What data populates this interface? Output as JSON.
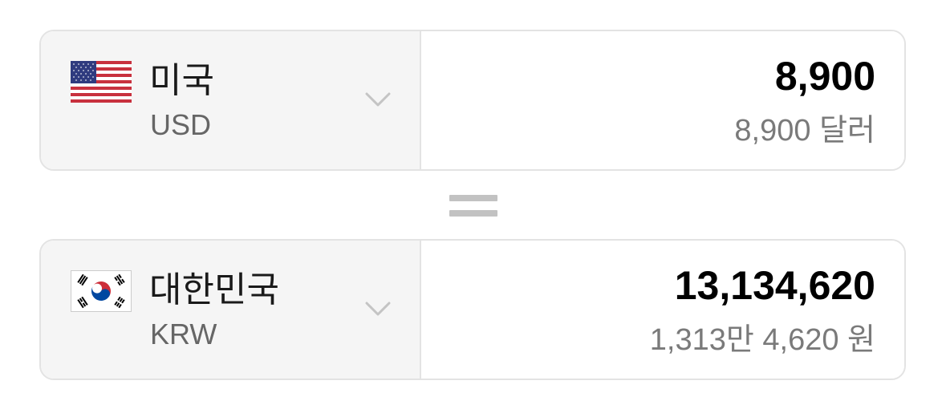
{
  "from": {
    "country": "미국",
    "code": "USD",
    "flag_icon": "us-flag-icon",
    "amount": "8,900",
    "amount_words": "8,900 달러"
  },
  "to": {
    "country": "대한민국",
    "code": "KRW",
    "flag_icon": "kr-flag-icon",
    "amount": "13,134,620",
    "amount_words": "1,313만 4,620 원"
  },
  "colors": {
    "border": "#e3e3e3",
    "select_bg": "#f5f5f5",
    "equals": "#c2c2c2",
    "secondary_text": "#7a7a7a"
  }
}
